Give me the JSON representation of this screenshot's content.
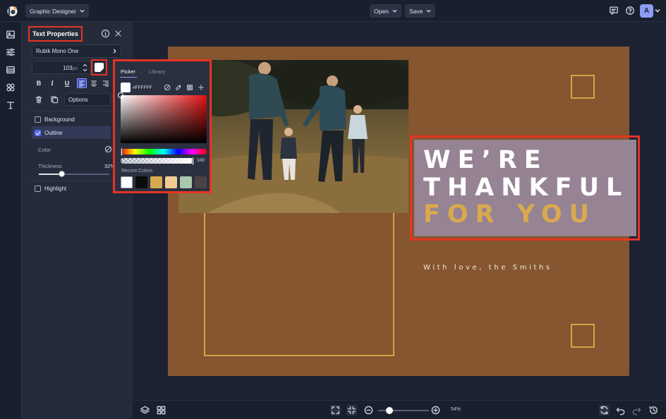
{
  "app": {
    "mode_label": "Graphic Designer",
    "open_label": "Open",
    "save_label": "Save",
    "avatar_initial": "A"
  },
  "panel": {
    "title": "Text Properties",
    "font_name": "Rubik Mono One",
    "font_size_value": "103",
    "font_size_unit": "px",
    "text_color": "#FFFFFF",
    "bold_label": "B",
    "italic_label": "I",
    "underline_label": "U",
    "options_label": "Options",
    "background_label": "Background",
    "outline_label": "Outline",
    "outline_color_label": "Color",
    "thickness_label": "Thickness",
    "thickness_value": "32%",
    "thickness_fraction": 0.32,
    "highlight_label": "Highlight",
    "background_checked": false,
    "outline_checked": true,
    "highlight_checked": false
  },
  "picker": {
    "tab_picker": "Picker",
    "tab_library": "Library",
    "hex_value": "#FFFFFF",
    "opacity_value": "100",
    "recent_label": "Recent Colors",
    "recent_colors": [
      "#FFFFFF",
      "#0B0B0B",
      "#D9A94E",
      "#EFCB92",
      "#A8C8A9",
      "#4A4344"
    ]
  },
  "canvas": {
    "background_color": "#85562F",
    "accent_color": "#D4A44A",
    "headline_line1": "WE’RE",
    "headline_line2": "THANKFUL",
    "headline_line3": "FOR YOU",
    "headline_color": "#FFFFFF",
    "headline_accent_color": "#D9A94E",
    "signature": "With love, the Smiths"
  },
  "bottombar": {
    "zoom_value": "54%",
    "zoom_fraction": 0.54
  },
  "icons": {
    "rail": [
      "image-icon",
      "adjustments-icon",
      "layout-icon",
      "shapes-icon",
      "text-icon"
    ],
    "top": [
      "comment-icon",
      "help-icon"
    ]
  }
}
